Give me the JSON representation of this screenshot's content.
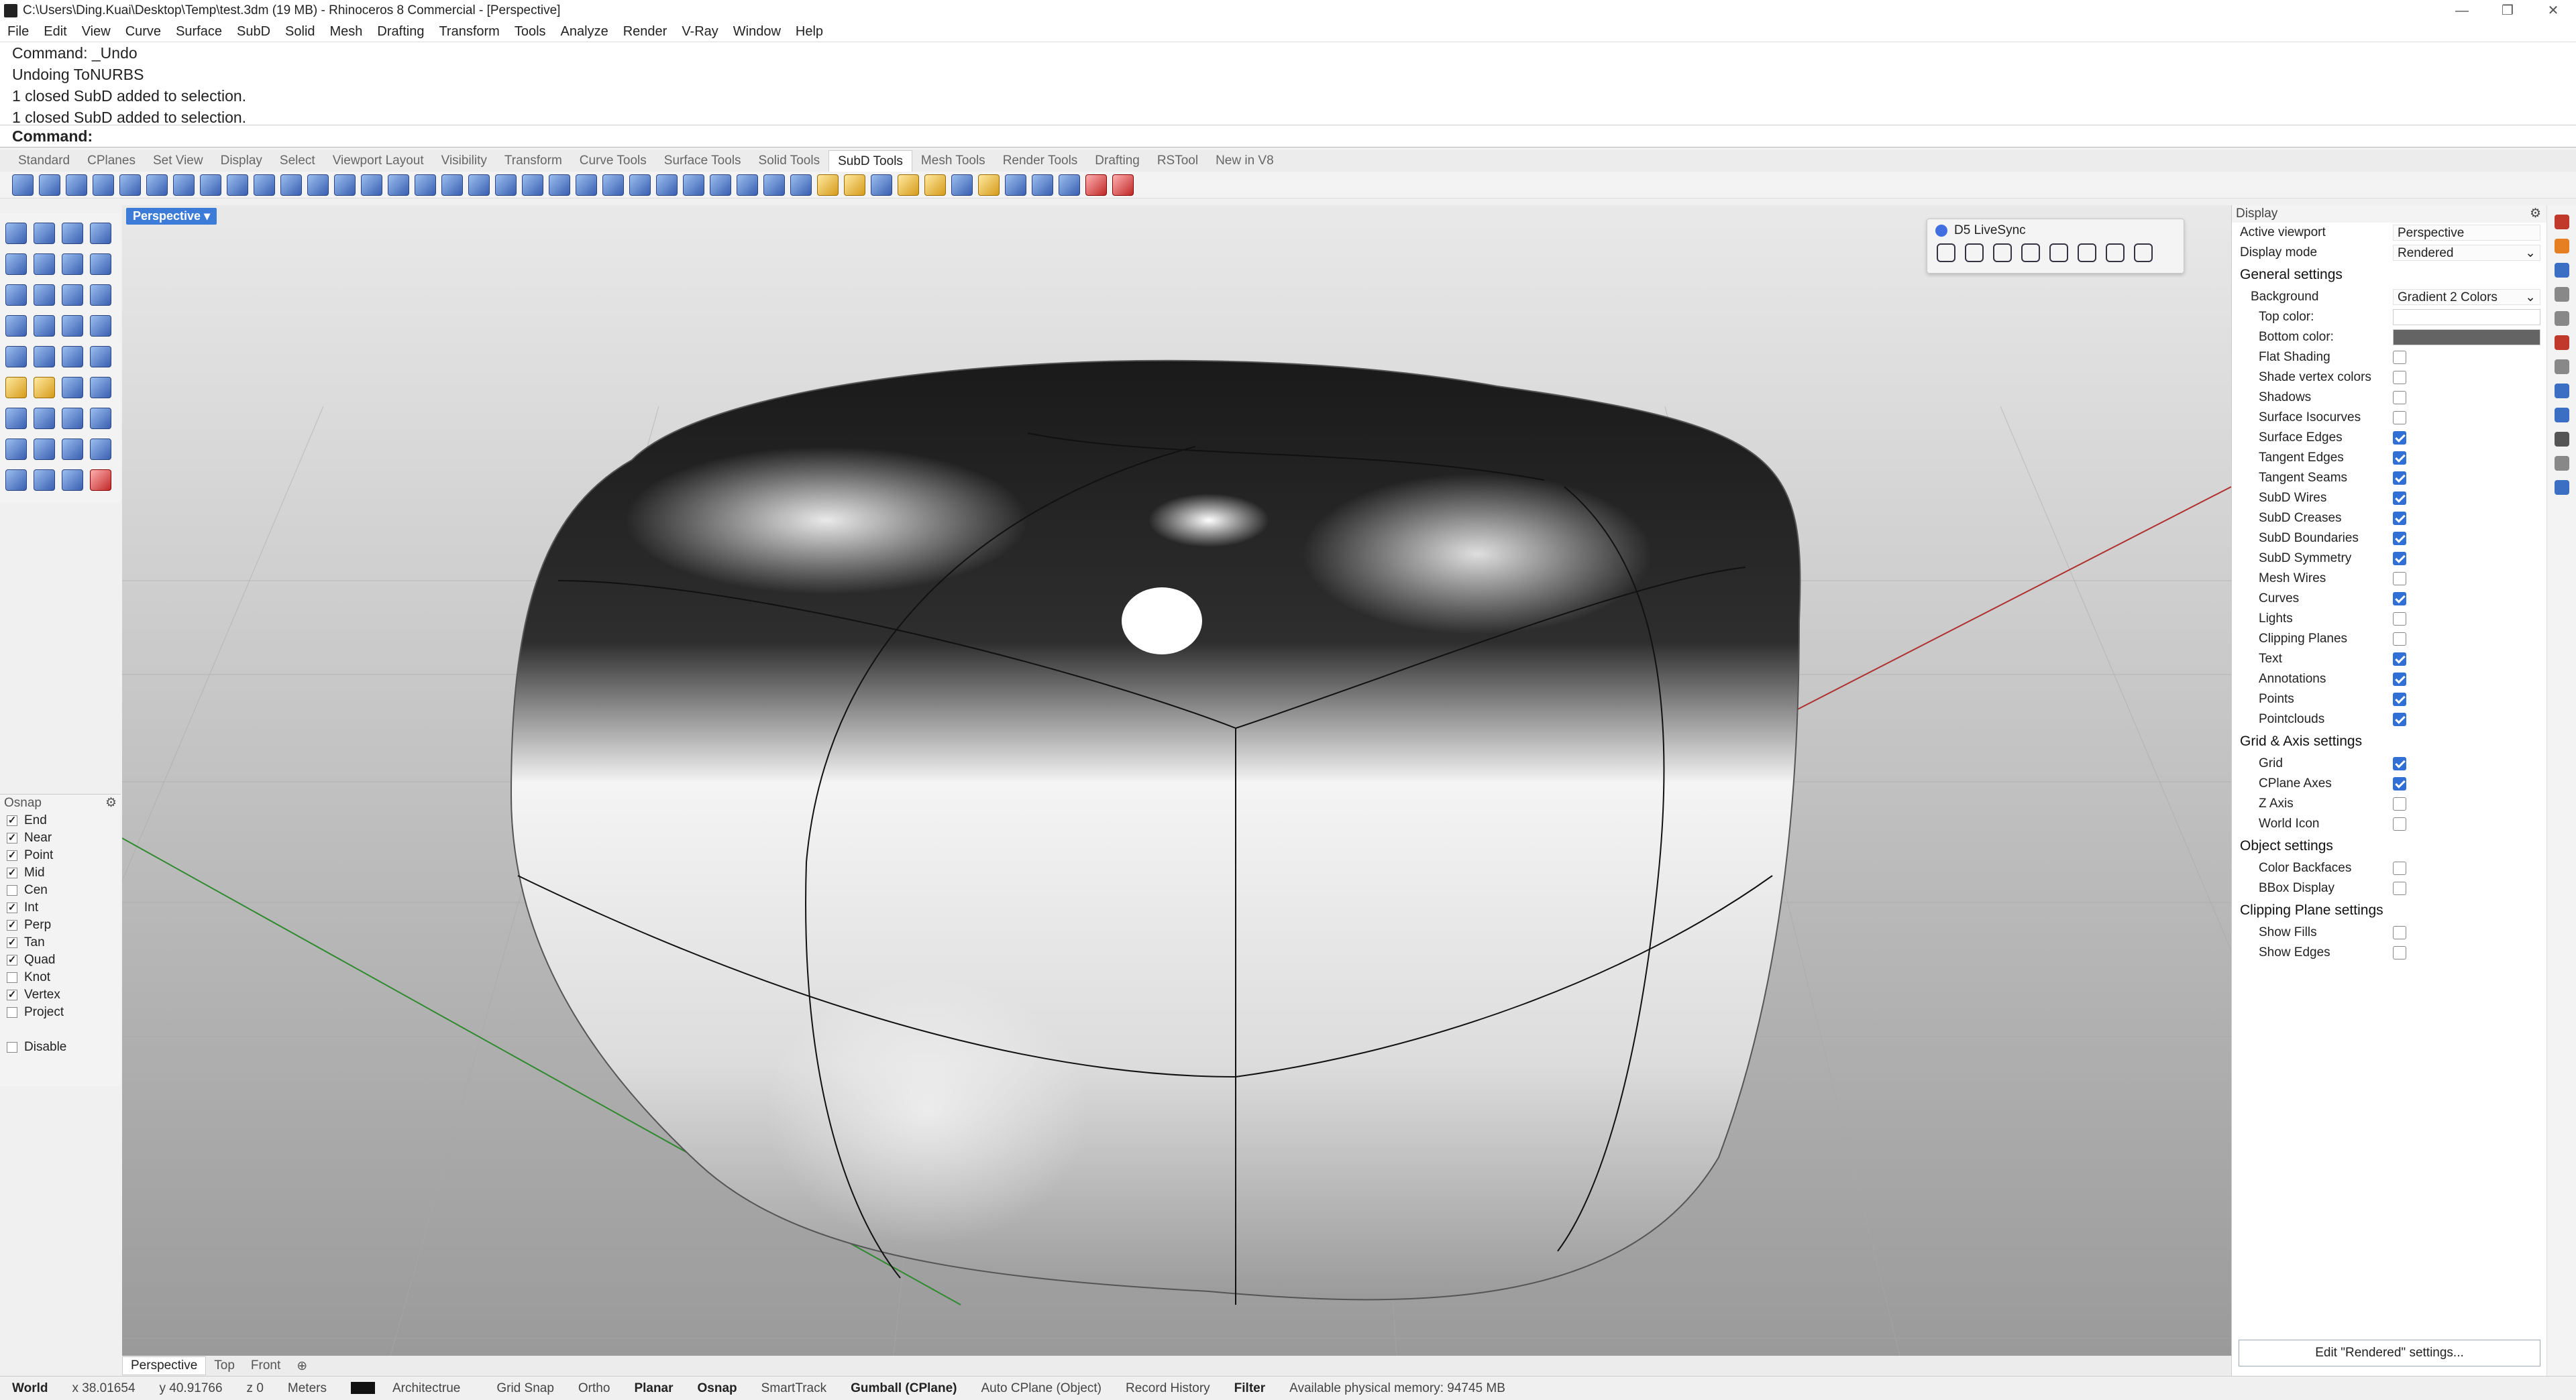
{
  "window": {
    "title": "C:\\Users\\Ding.Kuai\\Desktop\\Temp\\test.3dm (19 MB) - Rhinoceros 8 Commercial - [Perspective]",
    "minimize": "—",
    "restore": "❐",
    "close": "✕"
  },
  "menu": [
    "File",
    "Edit",
    "View",
    "Curve",
    "Surface",
    "SubD",
    "Solid",
    "Mesh",
    "Drafting",
    "Transform",
    "Tools",
    "Analyze",
    "Render",
    "V-Ray",
    "Window",
    "Help"
  ],
  "command_history": [
    "Command: _Undo",
    "Undoing ToNURBS",
    "1 closed SubD added to selection.",
    "1 closed SubD added to selection."
  ],
  "command_prompt": "Command:",
  "toolbar_tabs": [
    "Standard",
    "CPlanes",
    "Set View",
    "Display",
    "Select",
    "Viewport Layout",
    "Visibility",
    "Transform",
    "Curve Tools",
    "Surface Tools",
    "Solid Tools",
    "SubD Tools",
    "Mesh Tools",
    "Render Tools",
    "Drafting",
    "RSTool",
    "New in V8"
  ],
  "active_toolbar_tab": "SubD Tools",
  "viewport": {
    "label": "Perspective",
    "dropdown": "▾"
  },
  "livesync": {
    "title": "D5 LiveSync"
  },
  "osnap": {
    "title": "Osnap",
    "items": [
      {
        "label": "End",
        "checked": true
      },
      {
        "label": "Near",
        "checked": true
      },
      {
        "label": "Point",
        "checked": true
      },
      {
        "label": "Mid",
        "checked": true
      },
      {
        "label": "Cen",
        "checked": false
      },
      {
        "label": "Int",
        "checked": true
      },
      {
        "label": "Perp",
        "checked": true
      },
      {
        "label": "Tan",
        "checked": true
      },
      {
        "label": "Quad",
        "checked": true
      },
      {
        "label": "Knot",
        "checked": false
      },
      {
        "label": "Vertex",
        "checked": true
      },
      {
        "label": "Project",
        "checked": false
      }
    ],
    "disable": "Disable"
  },
  "viewport_tabs": [
    "Perspective",
    "Top",
    "Front"
  ],
  "viewport_tab_add": "⊕",
  "status": {
    "world": "World",
    "x": "x 38.01654",
    "y": "y 40.91766",
    "z": "z 0",
    "units": "Meters",
    "layer": "Architectrue",
    "grid_snap": "Grid Snap",
    "ortho": "Ortho",
    "planar": "Planar",
    "osnap": "Osnap",
    "smarttrack": "SmartTrack",
    "gumball": "Gumball (CPlane)",
    "auto_cplane": "Auto CPlane (Object)",
    "record_history": "Record History",
    "filter": "Filter",
    "memory": "Available physical memory: 94745 MB"
  },
  "display_panel": {
    "title": "Display",
    "active_viewport_label": "Active viewport",
    "active_viewport": "Perspective",
    "display_mode_label": "Display mode",
    "display_mode": "Rendered",
    "general_title": "General settings",
    "background_label": "Background",
    "background": "Gradient 2 Colors",
    "top_color_label": "Top color:",
    "top_color": "#ffffff",
    "bottom_color_label": "Bottom color:",
    "bottom_color": "#646464",
    "general": [
      {
        "label": "Flat Shading",
        "checked": false
      },
      {
        "label": "Shade vertex colors",
        "checked": false
      },
      {
        "label": "Shadows",
        "checked": false
      },
      {
        "label": "Surface Isocurves",
        "checked": false
      },
      {
        "label": "Surface Edges",
        "checked": true
      },
      {
        "label": "Tangent Edges",
        "checked": true
      },
      {
        "label": "Tangent Seams",
        "checked": true
      },
      {
        "label": "SubD Wires",
        "checked": true
      },
      {
        "label": "SubD Creases",
        "checked": true
      },
      {
        "label": "SubD Boundaries",
        "checked": true
      },
      {
        "label": "SubD Symmetry",
        "checked": true
      },
      {
        "label": "Mesh Wires",
        "checked": false
      },
      {
        "label": "Curves",
        "checked": true
      },
      {
        "label": "Lights",
        "checked": false
      },
      {
        "label": "Clipping Planes",
        "checked": false
      },
      {
        "label": "Text",
        "checked": true
      },
      {
        "label": "Annotations",
        "checked": true
      },
      {
        "label": "Points",
        "checked": true
      },
      {
        "label": "Pointclouds",
        "checked": true
      }
    ],
    "grid_title": "Grid & Axis settings",
    "grid": [
      {
        "label": "Grid",
        "checked": true
      },
      {
        "label": "CPlane Axes",
        "checked": true
      },
      {
        "label": "Z Axis",
        "checked": false
      },
      {
        "label": "World Icon",
        "checked": false
      }
    ],
    "object_title": "Object settings",
    "object": [
      {
        "label": "Color Backfaces",
        "checked": false
      },
      {
        "label": "BBox Display",
        "checked": false
      }
    ],
    "clipping_title": "Clipping Plane settings",
    "clipping": [
      {
        "label": "Show Fills",
        "checked": false
      },
      {
        "label": "Show Edges",
        "checked": false
      }
    ],
    "edit_button": "Edit \"Rendered\" settings..."
  },
  "colors": {
    "accent": "#2f6fd6",
    "viewport_label": "#3d7bd9",
    "x_axis": "#b03030",
    "y_axis": "#2f8a2f"
  }
}
